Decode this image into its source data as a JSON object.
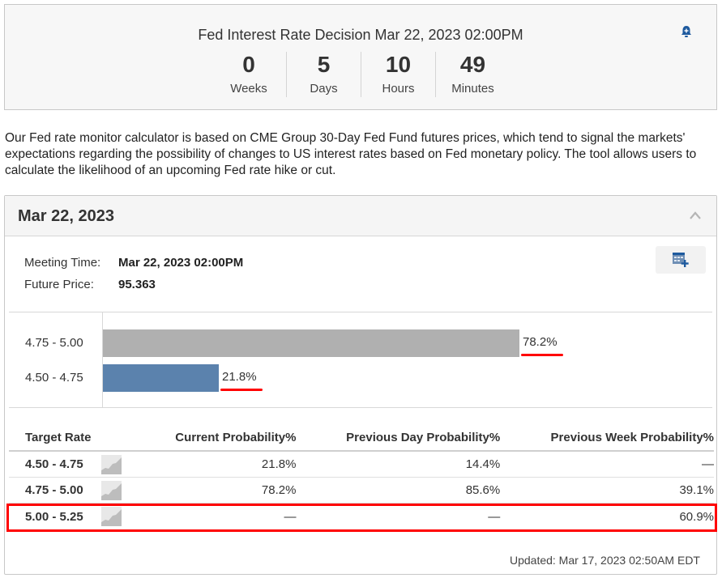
{
  "countdown": {
    "title": "Fed Interest Rate Decision Mar 22, 2023 02:00PM",
    "alert_icon": "bell-plus-icon",
    "units": [
      {
        "value": "0",
        "label": "Weeks"
      },
      {
        "value": "5",
        "label": "Days"
      },
      {
        "value": "10",
        "label": "Hours"
      },
      {
        "value": "49",
        "label": "Minutes"
      }
    ]
  },
  "description": "Our Fed rate monitor calculator is based on CME Group 30-Day Fed Fund futures prices, which tend to signal the markets' expectations regarding the possibility of changes to US interest rates based on Fed monetary policy. The tool allows users to calculate the likelihood of an upcoming Fed rate hike or cut.",
  "meeting": {
    "date": "Mar 22, 2023",
    "collapse_icon": "chevron-up-icon",
    "meeting_time_label": "Meeting Time:",
    "meeting_time_value": "Mar 22, 2023 02:00PM",
    "future_price_label": "Future Price:",
    "future_price_value": "95.363",
    "calendar_icon": "add-to-calendar-icon"
  },
  "chart_data": {
    "type": "bar",
    "orientation": "horizontal",
    "categories": [
      "4.75 - 5.00",
      "4.50 - 4.75"
    ],
    "values": [
      78.2,
      21.8
    ],
    "value_labels": [
      "78.2%",
      "21.8%"
    ],
    "colors": [
      "#b0b0b0",
      "#5b82ad"
    ],
    "xlim": [
      0,
      100
    ],
    "title": "",
    "xlabel": "",
    "ylabel": ""
  },
  "table": {
    "headers": [
      "Target Rate",
      "Current Probability%",
      "Previous Day Probability%",
      "Previous Week Probability%"
    ],
    "rows": [
      {
        "rate": "4.50 - 4.75",
        "current": "21.8%",
        "prev_day": "14.4%",
        "prev_week": "—"
      },
      {
        "rate": "4.75 - 5.00",
        "current": "78.2%",
        "prev_day": "85.6%",
        "prev_week": "39.1%"
      },
      {
        "rate": "5.00 - 5.25",
        "current": "—",
        "prev_day": "—",
        "prev_week": "60.9%"
      }
    ],
    "highlighted_row": 2
  },
  "updated": "Updated: Mar 17, 2023 02:50AM EDT",
  "colors": {
    "accent_blue": "#1e5a9e",
    "bar_gray": "#b0b0b0",
    "bar_blue": "#5b82ad",
    "annotation_red": "#ff0000"
  }
}
